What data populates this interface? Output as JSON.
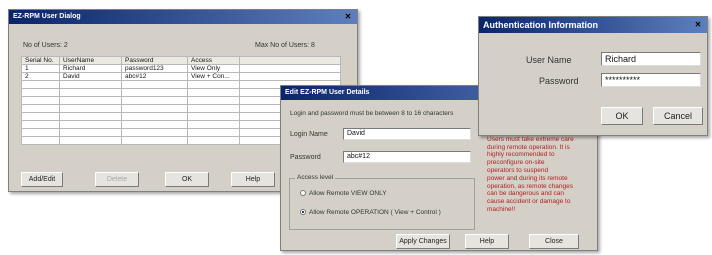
{
  "user_dialog": {
    "title": "EZ-RPM User Dialog",
    "close_label": "✕",
    "users_label": "No of Users: 2",
    "max_label": "Max No of Users: 8",
    "table": {
      "headers": [
        "Serial No.",
        "UserName",
        "Password",
        "Access"
      ],
      "rows": [
        [
          "1",
          "Richard",
          "password123",
          "View Only"
        ],
        [
          "2",
          "David",
          "abc#12",
          "View + Con..."
        ]
      ]
    },
    "buttons": {
      "add_edit": "Add/Edit",
      "delete": "Delete",
      "ok": "OK",
      "help": "Help"
    }
  },
  "details_dialog": {
    "title": "Edit EZ-RPM User Details",
    "instruction": "Login and password must be between 8 to 16 characters",
    "login_label": "Login Name",
    "login_value": "David",
    "password_label": "Password",
    "password_value": "abc#12",
    "access_group_label": "Access level",
    "radio_view": "Allow Remote VIEW ONLY",
    "radio_operation": "Allow Remote OPERATION ( View + Control )",
    "warning_note": "access.\nUsers must take extreme care\nduring remote operation. It is\nhighly recommended to\npreconfigure on-site\noperators to suspend\npower and during its remote\noperation, as remote changes\ncan be dangerous and can\ncause accident or damage to\nmachine!!",
    "buttons": {
      "apply": "Apply Changes",
      "help": "Help",
      "close": "Close"
    }
  },
  "auth_dialog": {
    "title": "Authentication Information",
    "close_label": "✕",
    "username_label": "User Name",
    "username_value": "Richard",
    "password_label": "Password",
    "password_value": "**********",
    "buttons": {
      "ok": "OK",
      "cancel": "Cancel"
    }
  }
}
